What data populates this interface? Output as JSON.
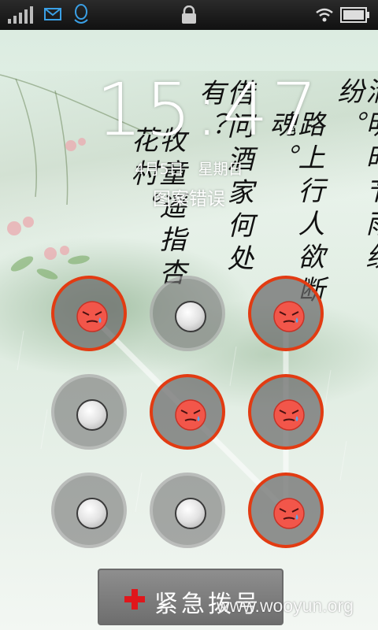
{
  "status_bar": {
    "signal_icon": "signal-bars-icon",
    "message_icon": "message-icon",
    "qq_icon": "qq-penguin-icon",
    "lock_icon": "lock-icon",
    "wifi_icon": "wifi-icon",
    "battery_icon": "battery-icon"
  },
  "lockscreen": {
    "time": "15:47",
    "date": "4月5日",
    "weekday": "星期日",
    "status_message": "图案错误"
  },
  "poem": {
    "columns": [
      "清明时节雨纷纷。",
      "路上行人欲断魂。",
      "借问酒家何处有？",
      "牧童遥指杏花村。"
    ]
  },
  "pattern": {
    "state": "error",
    "nodes": [
      {
        "id": 1,
        "selected": true
      },
      {
        "id": 2,
        "selected": false
      },
      {
        "id": 3,
        "selected": true
      },
      {
        "id": 4,
        "selected": false
      },
      {
        "id": 5,
        "selected": true
      },
      {
        "id": 6,
        "selected": true
      },
      {
        "id": 7,
        "selected": false
      },
      {
        "id": 8,
        "selected": false
      },
      {
        "id": 9,
        "selected": true
      }
    ],
    "sequence": [
      1,
      5,
      9,
      6,
      3
    ],
    "error_color": "#e23b12"
  },
  "emergency_button": {
    "label": "紧急拨号",
    "icon": "red-cross-icon"
  },
  "watermark": "www.wooyun.org"
}
